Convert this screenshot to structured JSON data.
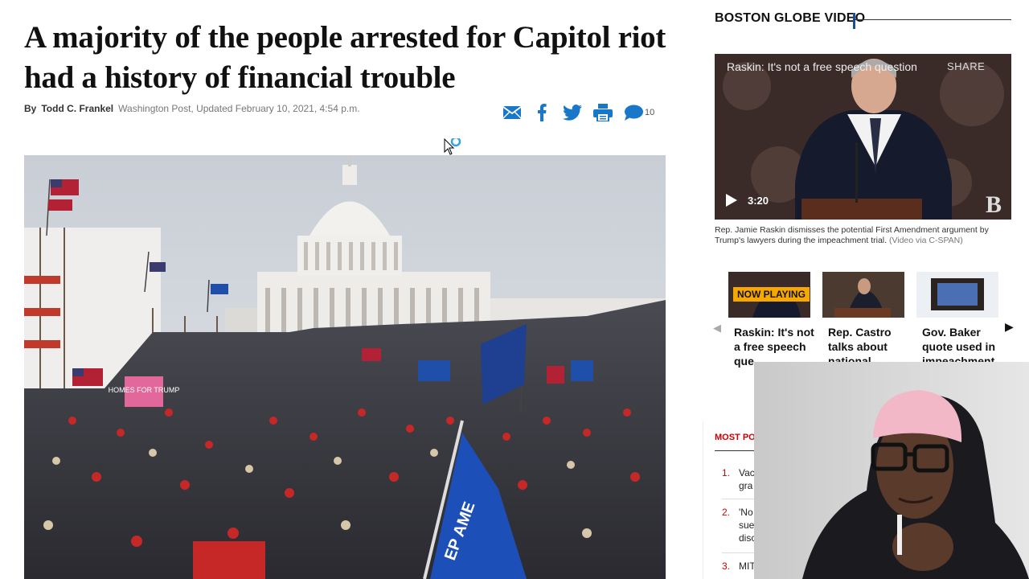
{
  "article": {
    "headline": "A majority of the people arrested for Capitol riot had a history of financial trouble",
    "by": "By",
    "author": "Todd C. Frankel",
    "meta": "Washington Post, Updated February 10, 2021, 4:54 p.m.",
    "comment_count": "10",
    "hero_sign_text": "HOMES FOR TRUMP",
    "flag_text": "EP AME"
  },
  "share_icons": [
    "email-icon",
    "facebook-icon",
    "twitter-icon",
    "print-icon",
    "comment-icon"
  ],
  "sidebar": {
    "section_title": "BOSTON GLOBE VIDEO",
    "video": {
      "title": "Raskin: It's not a free speech question",
      "share_label": "SHARE",
      "duration": "3:20",
      "logo": "B",
      "caption": "Rep. Jamie Raskin dismisses the potential First Amendment argument by Trump's lawyers during the impeachment trial.",
      "credit": "(Video via C-SPAN)"
    },
    "now_playing": "NOW PLAYING",
    "thumbs": [
      {
        "title": "Raskin: It's not a free speech que"
      },
      {
        "title": "Rep. Castro talks about national"
      },
      {
        "title": "Gov. Baker quote used in impeachment"
      }
    ],
    "most_popular": {
      "label": "MOST POP",
      "items": [
        {
          "num": "1.",
          "text": "Vac gra"
        },
        {
          "num": "2.",
          "text": "'No sue disc"
        },
        {
          "num": "3.",
          "text": "MIT"
        }
      ]
    }
  },
  "colors": {
    "accent_blue": "#1a4fa0",
    "now_playing_bg": "#f6a800",
    "most_popular_red": "#cc0000",
    "share_blue": "#1877c9"
  }
}
